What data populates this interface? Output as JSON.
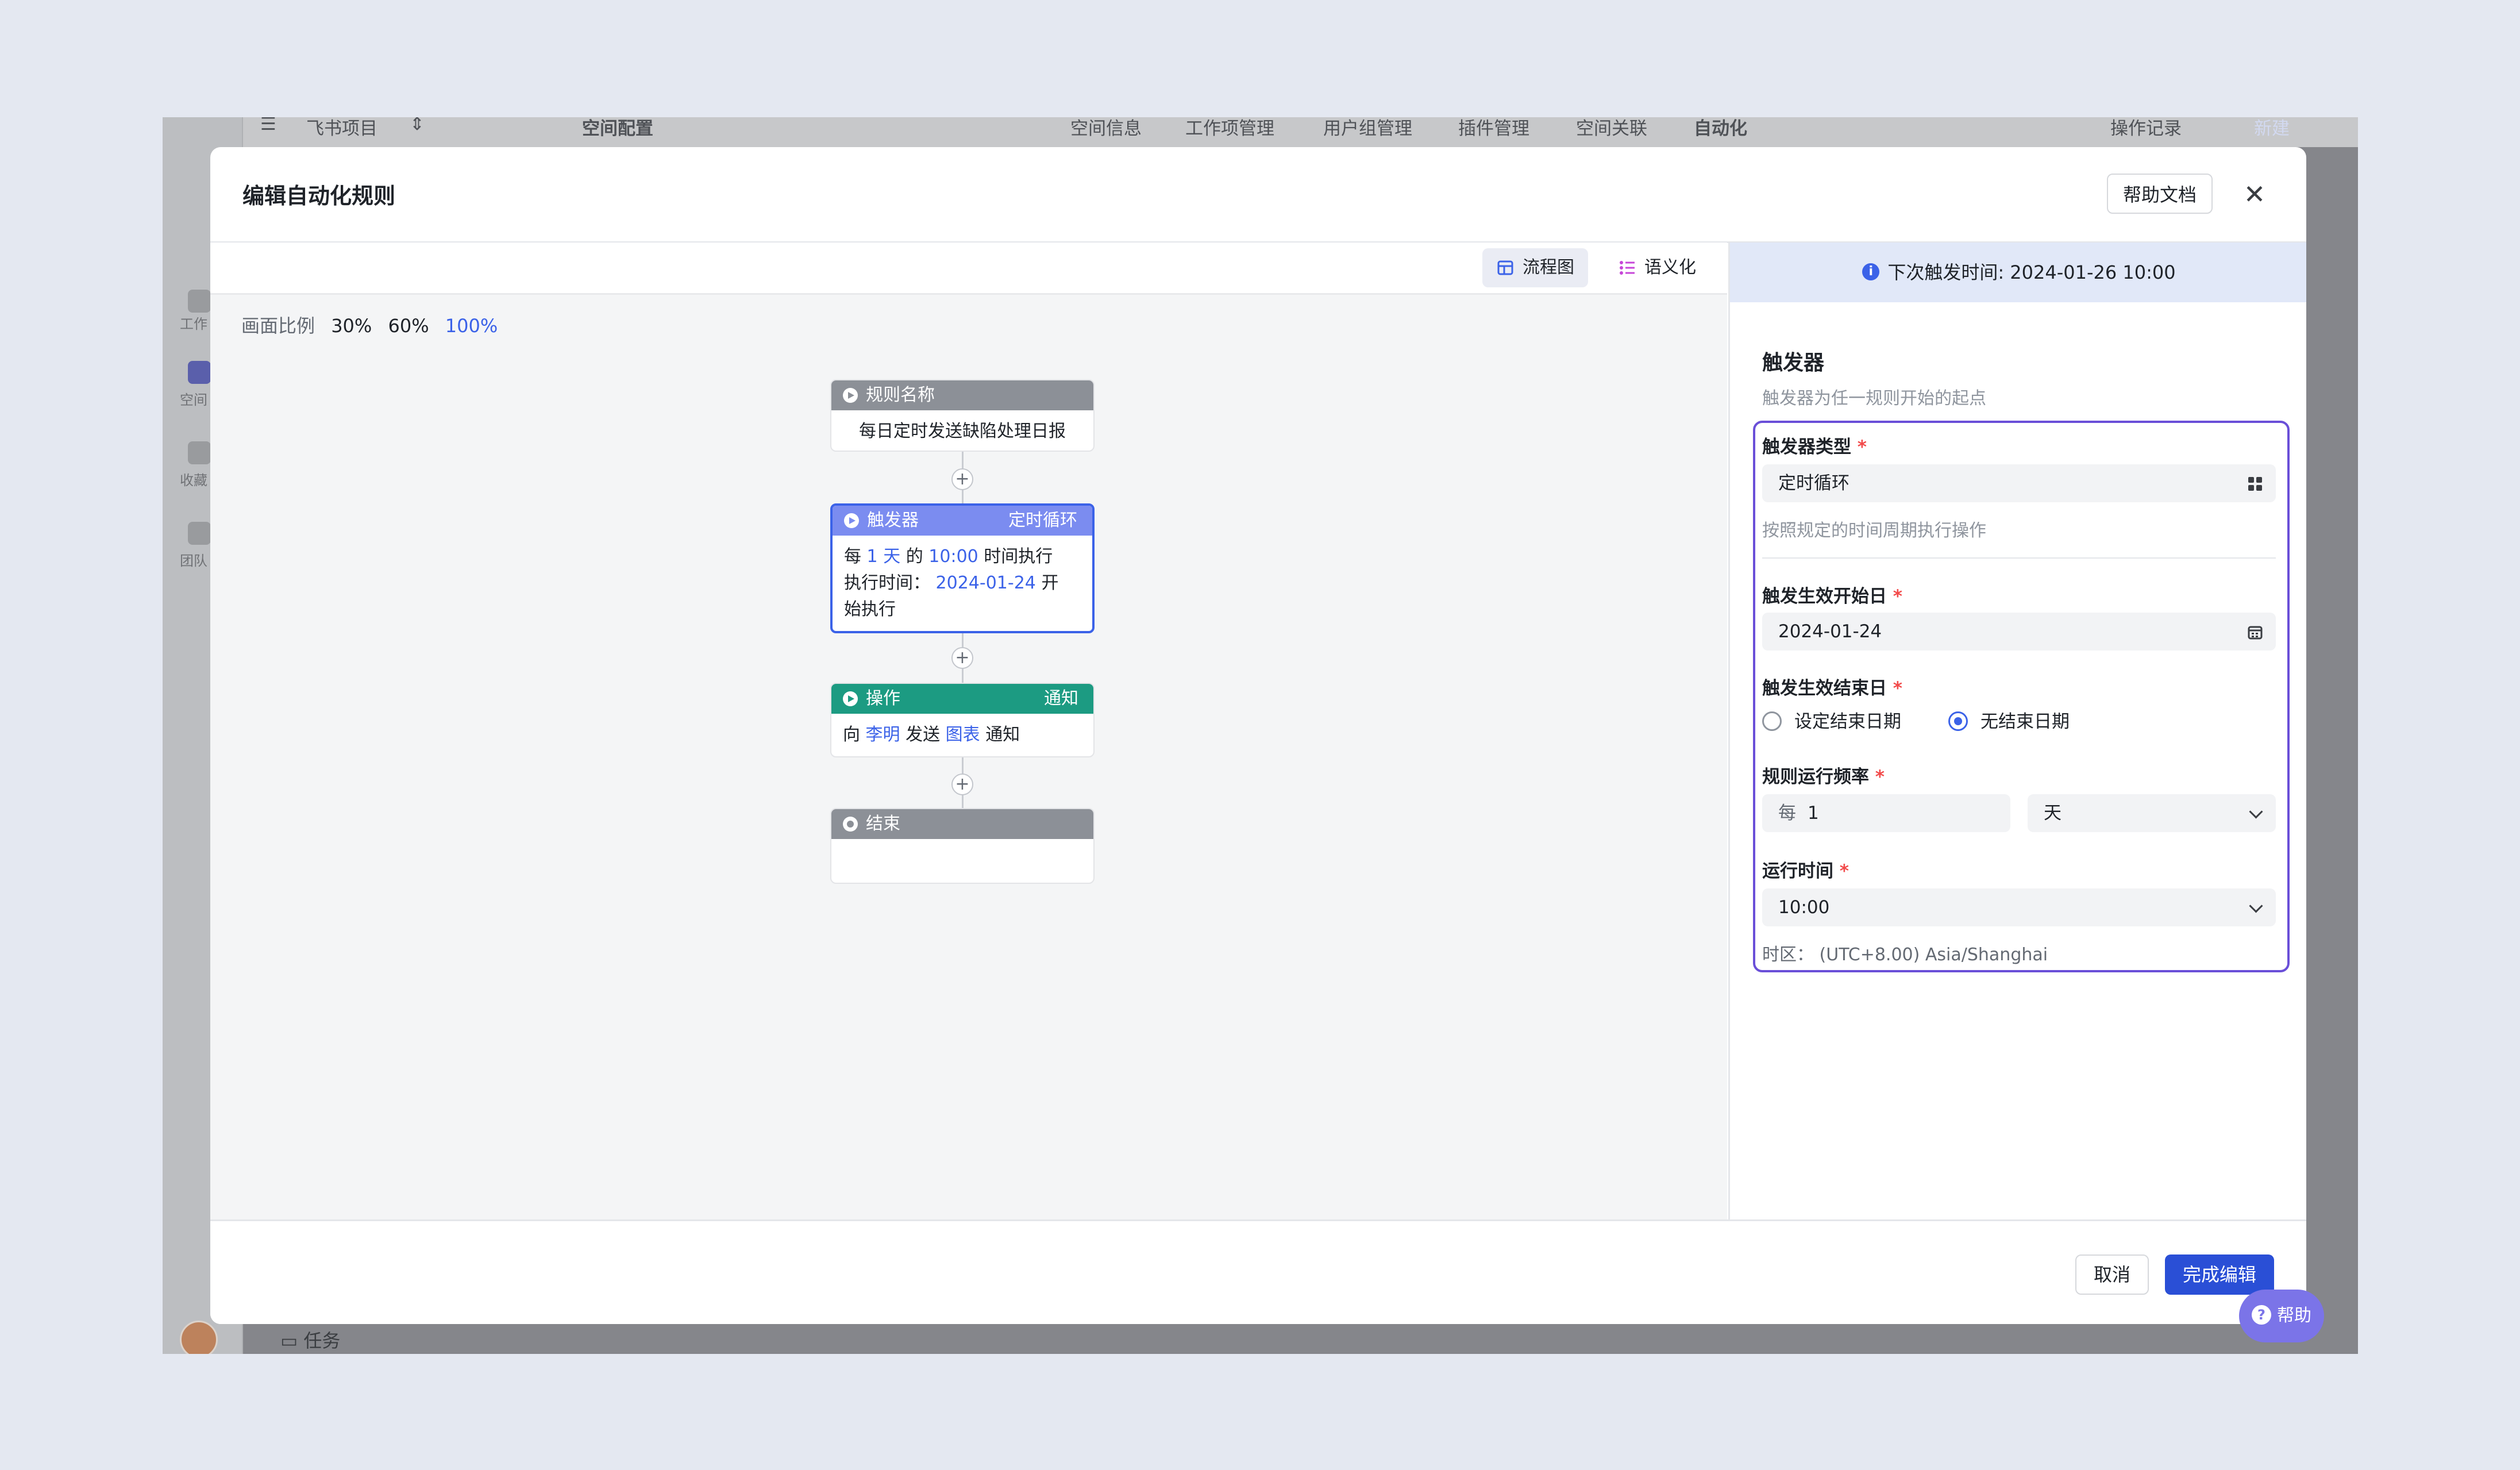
{
  "background_app": {
    "project_name": "飞书项目",
    "page_title": "空间配置",
    "tabs": [
      "空间信息",
      "工作项管理",
      "用户组管理",
      "插件管理",
      "空间关联",
      "自动化"
    ],
    "operation_log": "操作记录",
    "new_button": "新建",
    "nav": [
      "工作",
      "空间",
      "收藏",
      "团队"
    ],
    "bottom_item": "任务"
  },
  "modal": {
    "title": "编辑自动化规则",
    "help_doc": "帮助文档",
    "close": "✕"
  },
  "canvas": {
    "view_tabs": [
      "流程图",
      "语义化"
    ],
    "scale_label": "画面比例",
    "scale_options": [
      "30%",
      "60%",
      "100%"
    ],
    "nodes": {
      "rule_name": {
        "title": "规则名称",
        "body": "每日定时发送缺陷处理日报"
      },
      "trigger": {
        "title": "触发器",
        "tag": "定时循环",
        "line1_pre": "每",
        "every_value": "1",
        "unit": "天",
        "of": "的",
        "time": "10:00",
        "line1_post": "时间执行",
        "line2_pre": "执行时间：",
        "date": "2024-01-24",
        "line2_post": "开",
        "line3": "始执行"
      },
      "action": {
        "title": "操作",
        "tag": "通知",
        "pre": "向",
        "person": "李明",
        "mid": "发送",
        "content": "图表",
        "post": "通知"
      },
      "end": {
        "title": "结束"
      }
    },
    "plus": "+"
  },
  "panel": {
    "next_trigger": "下次触发时间: 2024-01-26 10:00",
    "section_title": "触发器",
    "section_sub": "触发器为任一规则开始的起点",
    "trigger_type_label": "触发器类型",
    "trigger_type_value": "定时循环",
    "trigger_type_hint": "按照规定的时间周期执行操作",
    "start_date_label": "触发生效开始日",
    "start_date_value": "2024-01-24",
    "end_date_label": "触发生效结束日",
    "end_options": [
      "设定结束日期",
      "无结束日期"
    ],
    "end_selected": "无结束日期",
    "freq_label": "规则运行频率",
    "freq_prefix": "每",
    "freq_value": "1",
    "freq_unit": "天",
    "run_time_label": "运行时间",
    "run_time_value": "10:00",
    "timezone": "时区： (UTC+8.00) Asia/Shanghai",
    "required_mark": "*"
  },
  "footer": {
    "cancel": "取消",
    "done": "完成编辑"
  },
  "help_fab": "帮助",
  "colors": {
    "accent": "#3b62e8",
    "trigger_header": "#7b8cf0",
    "action_header": "#1c9b82",
    "neutral_header": "#8c9097",
    "highlight_border": "#6a4fd8"
  }
}
